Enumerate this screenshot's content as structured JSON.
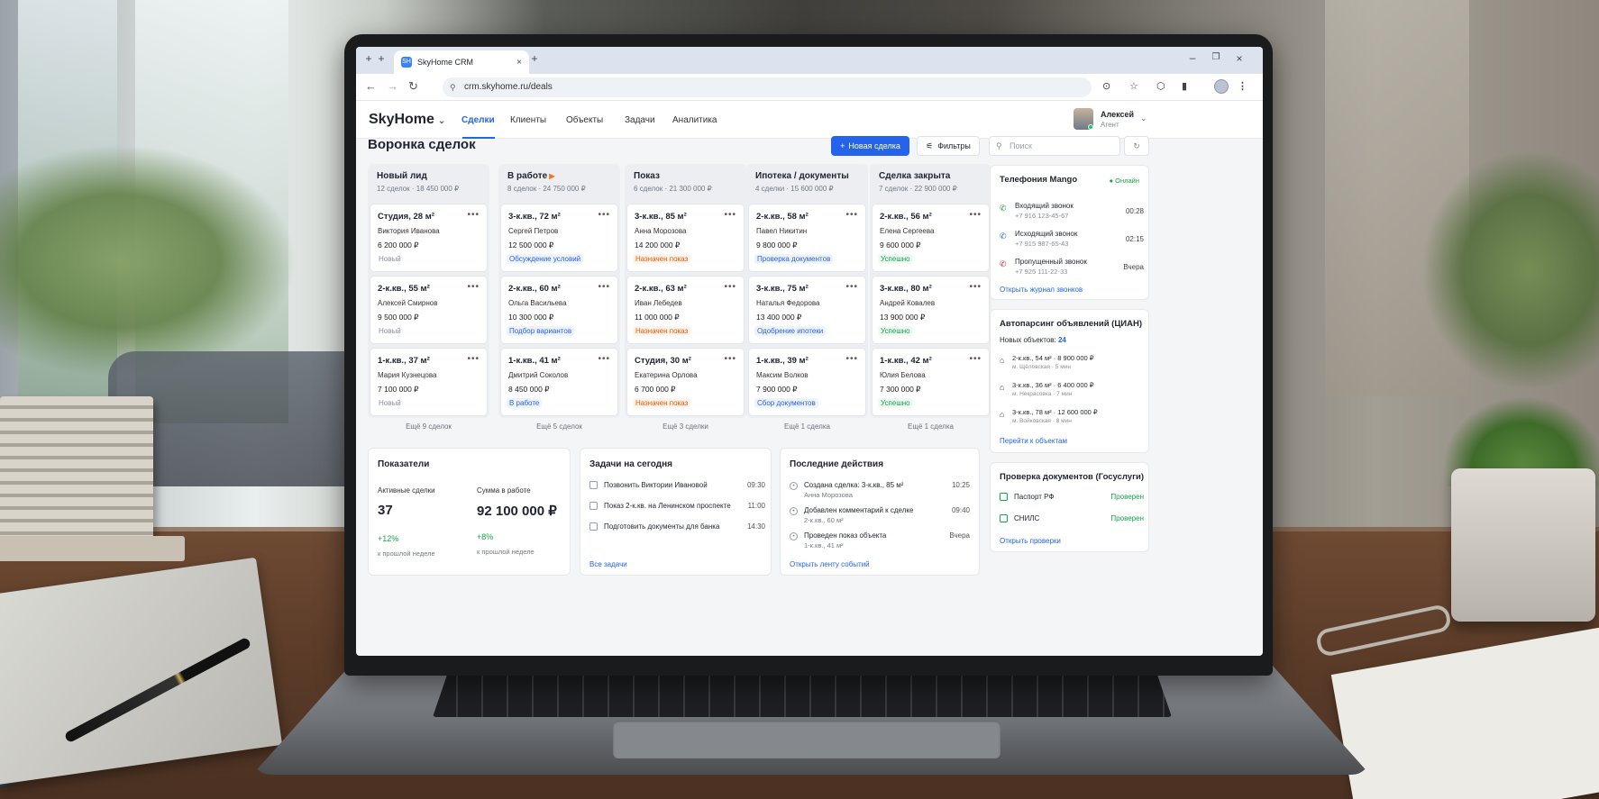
{
  "browser": {
    "tab_title": "SkyHome CRM",
    "tab_favicon": "SH",
    "url": "crm.skyhome.ru/deals"
  },
  "app": {
    "logo": "SkyHome",
    "nav": [
      "Сделки",
      "Клиенты",
      "Объекты",
      "Задачи",
      "Аналитика"
    ],
    "user_name": "Алексей",
    "user_role": "Агент"
  },
  "toolbar": {
    "title": "Воронка сделок",
    "new_deal": "Новая сделка",
    "filters": "Фильтры",
    "search_placeholder": "Поиск"
  },
  "board": {
    "columns": [
      {
        "title": "Новый лид",
        "summary": "12 сделок · 18 450 000 ₽",
        "more": "Ещё 9 сделок",
        "cards": [
          {
            "title": "Студия, 28 м²",
            "client": "Виктория Иванова",
            "price": "6 200 000 ₽",
            "status": "Новый",
            "tone": "gray"
          },
          {
            "title": "2-к.кв., 55 м²",
            "client": "Алексей Смирнов",
            "price": "9 500 000 ₽",
            "status": "Новый",
            "tone": "gray"
          },
          {
            "title": "1-к.кв., 37 м²",
            "client": "Мария Кузнецова",
            "price": "7 100 000 ₽",
            "status": "Новый",
            "tone": "gray"
          }
        ]
      },
      {
        "title": "В работе",
        "summary": "8 сделок · 24 750 000 ₽",
        "more": "Ещё 5 сделок",
        "cards": [
          {
            "title": "3-к.кв., 72 м²",
            "client": "Сергей Петров",
            "price": "12 500 000 ₽",
            "status": "Обсуждение условий",
            "tone": "blue"
          },
          {
            "title": "2-к.кв., 60 м²",
            "client": "Ольга Васильева",
            "price": "10 300 000 ₽",
            "status": "Подбор вариантов",
            "tone": "blue"
          },
          {
            "title": "1-к.кв., 41 м²",
            "client": "Дмитрий Соколов",
            "price": "8 450 000 ₽",
            "status": "В работе",
            "tone": "blue"
          }
        ]
      },
      {
        "title": "Показ",
        "summary": "6 сделок · 21 300 000 ₽",
        "more": "Ещё 3 сделки",
        "cards": [
          {
            "title": "3-к.кв., 85 м²",
            "client": "Анна Морозова",
            "price": "14 200 000 ₽",
            "status": "Назначен показ",
            "tone": "orange"
          },
          {
            "title": "2-к.кв., 63 м²",
            "client": "Иван Лебедев",
            "price": "11 000 000 ₽",
            "status": "Назначен показ",
            "tone": "orange"
          },
          {
            "title": "Студия, 30 м²",
            "client": "Екатерина Орлова",
            "price": "6 700 000 ₽",
            "status": "Назначен показ",
            "tone": "orange"
          }
        ]
      },
      {
        "title": "Ипотека / документы",
        "summary": "4 сделки · 15 600 000 ₽",
        "more": "Ещё 1 сделка",
        "cards": [
          {
            "title": "2-к.кв., 58 м²",
            "client": "Павел Никитин",
            "price": "9 800 000 ₽",
            "status": "Проверка документов",
            "tone": "blue"
          },
          {
            "title": "3-к.кв., 75 м²",
            "client": "Наталья Федорова",
            "price": "13 400 000 ₽",
            "status": "Одобрение ипотеки",
            "tone": "blue"
          },
          {
            "title": "1-к.кв., 39 м²",
            "client": "Максим Волков",
            "price": "7 900 000 ₽",
            "status": "Сбор документов",
            "tone": "blue"
          }
        ]
      },
      {
        "title": "Сделка закрыта",
        "summary": "7 сделок · 22 900 000 ₽",
        "more": "Ещё 1 сделка",
        "cards": [
          {
            "title": "2-к.кв., 56 м²",
            "client": "Елена Сергеева",
            "price": "9 600 000 ₽",
            "status": "Успешно",
            "tone": "green"
          },
          {
            "title": "3-к.кв., 80 м²",
            "client": "Андрей Ковалев",
            "price": "13 900 000 ₽",
            "status": "Успешно",
            "tone": "green"
          },
          {
            "title": "1-к.кв., 42 м²",
            "client": "Юлия Белова",
            "price": "7 300 000 ₽",
            "status": "Успешно",
            "tone": "green"
          }
        ]
      }
    ]
  },
  "telephony": {
    "title": "Телефония Mango",
    "status": "● Онлайн",
    "calls": [
      {
        "label": "Входящий звонок",
        "number": "+7 916 123-45-67",
        "time": "00:28",
        "icon": "phone-incoming-icon"
      },
      {
        "label": "Исходящий звонок",
        "number": "+7 915 987-65-43",
        "time": "02:15",
        "icon": "phone-outgoing-icon"
      },
      {
        "label": "Пропущенный звонок",
        "number": "+7 925 111-22-33",
        "time": "Вчера",
        "icon": "phone-missed-icon"
      }
    ],
    "link": "Открыть журнал звонков"
  },
  "parsing": {
    "title": "Автопарсинг объявлений (ЦИАН)",
    "new_label": "Новых объектов:",
    "new_count": "24",
    "items": [
      {
        "title": "2-к.кв., 54 м² · 8 900 000 ₽",
        "meta": "м. Щёловская · 5 мин"
      },
      {
        "title": "3-к.кв., 36 м² · 6 400 000 ₽",
        "meta": "м. Некрасовка · 7 мин"
      },
      {
        "title": "3-к.кв., 78 м² · 12 600 000 ₽",
        "meta": "м. Войковская · 8 мин"
      }
    ],
    "link": "Перейти к объектам"
  },
  "documents": {
    "title": "Проверка документов (Госуслуги)",
    "items": [
      {
        "label": "Паспорт РФ",
        "status": "Проверен"
      },
      {
        "label": "СНИЛС",
        "status": "Проверен"
      }
    ],
    "link": "Открыть проверки"
  },
  "kpi": {
    "title": "Показатели",
    "active_label": "Активные сделки",
    "active_value": "37",
    "active_delta": "+12%",
    "active_caption": "к прошлой неделе",
    "sum_label": "Сумма в работе",
    "sum_value": "92 100 000 ₽",
    "sum_delta": "+8%",
    "sum_caption": "к прошлой неделе"
  },
  "tasks": {
    "title": "Задачи на сегодня",
    "items": [
      {
        "label": "Позвонить Виктории Ивановой",
        "time": "09:30"
      },
      {
        "label": "Показ 2-к.кв. на Ленинском проспекте",
        "time": "11:00"
      },
      {
        "label": "Подготовить документы для банка",
        "time": "14:30"
      }
    ],
    "link": "Все задачи"
  },
  "activity": {
    "title": "Последние действия",
    "items": [
      {
        "label": "Создана сделка: 3-к.кв., 85 м²",
        "sub": "Анна Морозова",
        "time": "10:25"
      },
      {
        "label": "Добавлен комментарий к сделке",
        "sub": "2-к.кв., 60 м²",
        "time": "09:40"
      },
      {
        "label": "Проведен показ объекта",
        "sub": "1-к.кв., 41 м²",
        "time": "Вчера"
      }
    ],
    "link": "Открыть ленту событий"
  }
}
